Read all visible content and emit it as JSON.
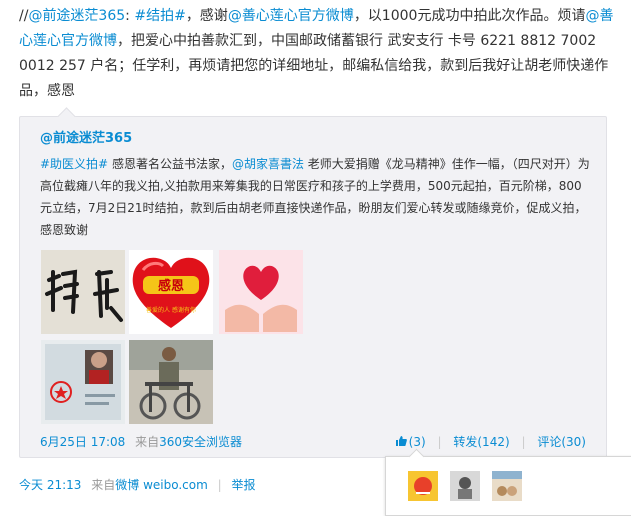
{
  "post": {
    "prefix": "//",
    "mention_author": "@前途迷茫365",
    "tag": "#结拍#",
    "text_1": "，感谢",
    "mention_charity": "@善心莲心官方微博",
    "text_2": "，以1000元成功中拍此次作品。烦请",
    "text_3": "，把爱心中拍善款汇到，中国邮政储蓄银行 武安支行 卡号 6221 8812 7002 0012 257 户名；任学利，再烦请把您的详细地址，邮编私信给我，款到后我好让胡老师快递作品，感恩"
  },
  "quote": {
    "author": "@前途迷茫365",
    "tag": "#助医义拍#",
    "text_1": " 感恩著名公益书法家，",
    "mention": "@胡家喜書法",
    "text_2": " 老师大爱捐赠《龙马精神》佳作一幅，（四尺对开）为高位截瘫八年的我义拍,义拍款用来筹集我的日常医疗和孩子的上学费用，500元起拍，百元阶梯，800元立结，7月2日21时结拍，款到后由胡老师直接快递作品，盼朋友们爱心转发或随缘竞价，促成义拍，感恩致谢",
    "heart_text": "感恩",
    "heart_subtext": "善爱的人 感谢有你",
    "time": "6月25日 17:08",
    "source_prefix": "来自",
    "source": "360安全浏览器",
    "like_count": "(3)",
    "repost": "转发(142)",
    "comment": "评论(30)"
  },
  "footer": {
    "time": "今天 21:13",
    "source_prefix": "来自",
    "source": "微博 weibo.com",
    "sep": "|",
    "report": "举报"
  },
  "colors": {
    "link": "#0a8cd2",
    "meta": "#999999",
    "quote_bg": "#f2f2f5"
  }
}
